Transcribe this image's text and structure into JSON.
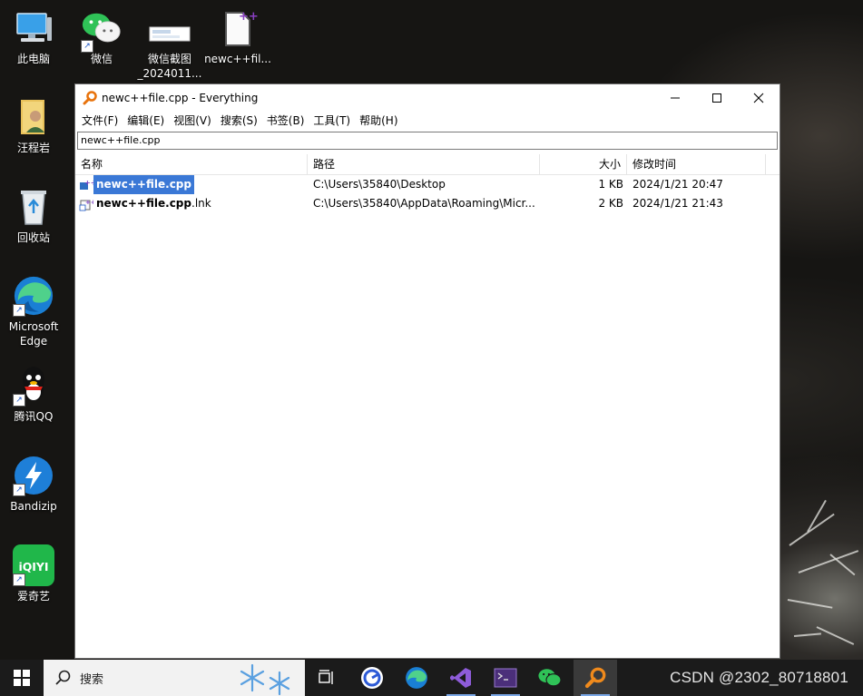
{
  "desktop": {
    "icons": [
      {
        "label": "此电脑",
        "icon": "computer-icon"
      },
      {
        "label": "微信",
        "icon": "wechat-icon"
      },
      {
        "label": "微信截图\n_2024011...",
        "icon": "image-file-icon"
      },
      {
        "label": "newc++fil...",
        "icon": "cpp-file-icon"
      },
      {
        "label": "汪程岩",
        "icon": "user-folder-icon"
      },
      {
        "label": "回收站",
        "icon": "recycle-bin-icon"
      },
      {
        "label": "Microsoft\nEdge",
        "icon": "edge-icon"
      },
      {
        "label": "腾讯QQ",
        "icon": "qq-icon"
      },
      {
        "label": "Bandizip",
        "icon": "bandizip-icon"
      },
      {
        "label": "爱奇艺",
        "icon": "iqiyi-icon"
      }
    ]
  },
  "window": {
    "title": "newc++file.cpp - Everything",
    "menu": [
      "文件(F)",
      "编辑(E)",
      "视图(V)",
      "搜索(S)",
      "书签(B)",
      "工具(T)",
      "帮助(H)"
    ],
    "search_value": "newc++file.cpp",
    "columns": {
      "name": "名称",
      "path": "路径",
      "size": "大小",
      "modified": "修改时间"
    },
    "rows": [
      {
        "name": "newc++file.cpp",
        "name_bold": "newc++file.cpp",
        "name_rest": "",
        "path": "C:\\Users\\35840\\Desktop",
        "size": "1 KB",
        "modified": "2024/1/21 20:47",
        "selected": true
      },
      {
        "name": "newc++file.cpp.lnk",
        "name_bold": "newc++file.cpp",
        "name_rest": ".lnk",
        "path": "C:\\Users\\35840\\AppData\\Roaming\\Micr...",
        "size": "2 KB",
        "modified": "2024/1/21 21:43",
        "selected": false
      }
    ]
  },
  "taskbar": {
    "search_label": "搜索",
    "items": [
      "task-view-icon",
      "browser-icon",
      "edge-icon",
      "visual-studio-icon",
      "terminal-icon",
      "wechat-icon",
      "everything-icon"
    ],
    "active_item": "everything-icon",
    "watermark": "CSDN @2302_80718801"
  },
  "colors": {
    "selection": "#3a78d6",
    "taskbar": "#1b1b1b",
    "search_bg": "#f2f2f2"
  }
}
